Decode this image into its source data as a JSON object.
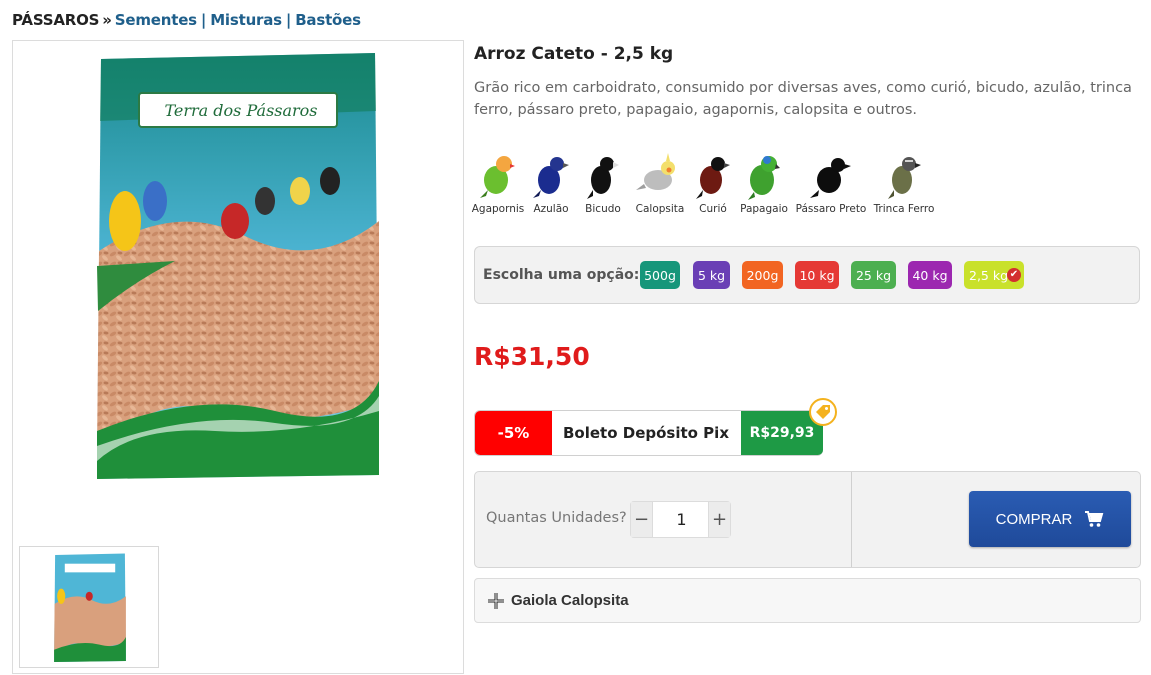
{
  "breadcrumb": {
    "root": "PÁSSAROS",
    "separator": "»",
    "links": [
      "Sementes",
      "Misturas",
      "Bastões"
    ]
  },
  "product": {
    "title": "Arroz Cateto - 2,5 kg",
    "description": "Grão rico em carboidrato, consumido por diversas aves, como curió, bicudo, azulão, trinca ferro, pássaro preto, papagaio, agapornis, calopsita e outros.",
    "brand_label": "Terra dos Pássaros"
  },
  "birds": [
    {
      "name": "Agapornis",
      "icon": "lovebird-icon"
    },
    {
      "name": "Azulão",
      "icon": "blue-grosbeak-icon"
    },
    {
      "name": "Bicudo",
      "icon": "bicudo-icon"
    },
    {
      "name": "Calopsita",
      "icon": "cockatiel-icon"
    },
    {
      "name": "Curió",
      "icon": "curio-icon"
    },
    {
      "name": "Papagaio",
      "icon": "parrot-icon"
    },
    {
      "name": "Pássaro Preto",
      "icon": "blackbird-icon"
    },
    {
      "name": "Trinca Ferro",
      "icon": "saltator-icon"
    }
  ],
  "options": {
    "label": "Escolha uma opção:",
    "items": [
      {
        "label": "500g",
        "color": "#16967a"
      },
      {
        "label": "5 kg",
        "color": "#6a3fb5"
      },
      {
        "label": "200g",
        "color": "#f26522"
      },
      {
        "label": "10 kg",
        "color": "#e53935"
      },
      {
        "label": "25 kg",
        "color": "#4caf50"
      },
      {
        "label": "40 kg",
        "color": "#9c27b0"
      },
      {
        "label": "2,5 kg",
        "color": "#c9e12b",
        "selected": true
      }
    ]
  },
  "price": "R$31,50",
  "discount": {
    "percent": "-5%",
    "label": "Boleto Depósito Pix",
    "price": "R$29,93"
  },
  "purchase": {
    "qty_label": "Quantas Unidades?",
    "qty_value": "1",
    "minus": "−",
    "plus": "+",
    "buy_label": "COMPRAR"
  },
  "accessory": {
    "label": "Gaiola Calopsita"
  },
  "colors": {
    "price": "#e01b1b",
    "link": "#1f5f8b",
    "buy_button": "#2a5cb3",
    "discount_red": "#ff0000",
    "discount_green": "#1e9a45"
  }
}
